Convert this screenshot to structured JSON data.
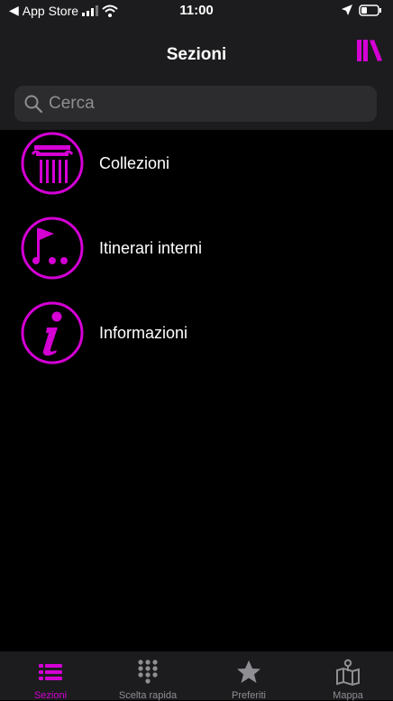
{
  "statusbar": {
    "carrier": "App Store",
    "time": "11:00"
  },
  "navbar": {
    "title": "Sezioni"
  },
  "search": {
    "placeholder": "Cerca"
  },
  "colors": {
    "accent": "#d400d4",
    "bar_bg": "#1c1c1e",
    "background": "#000000"
  },
  "sections": [
    {
      "label": "Collezioni",
      "icon": "column-icon"
    },
    {
      "label": "Itinerari interni",
      "icon": "flag-route-icon"
    },
    {
      "label": "Informazioni",
      "icon": "info-icon"
    }
  ],
  "tabs": [
    {
      "label": "Sezioni",
      "icon": "list-icon",
      "active": true
    },
    {
      "label": "Scelta rapida",
      "icon": "keypad-icon",
      "active": false
    },
    {
      "label": "Preferiti",
      "icon": "star-icon",
      "active": false
    },
    {
      "label": "Mappa",
      "icon": "map-icon",
      "active": false
    }
  ]
}
